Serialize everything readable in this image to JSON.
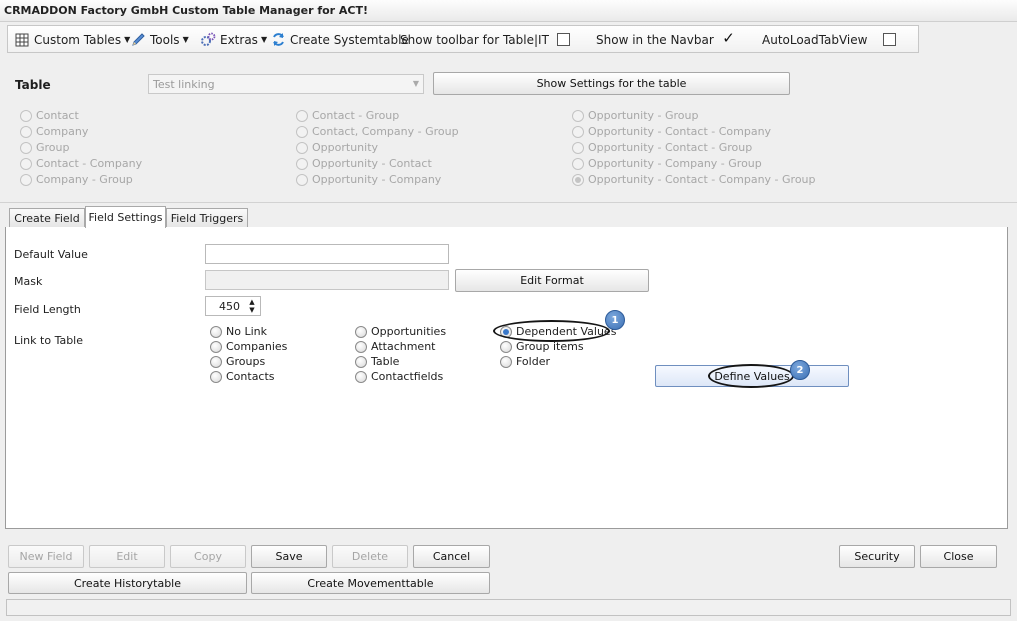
{
  "window": {
    "title": "CRMADDON Factory GmbH Custom Table Manager for ACT!"
  },
  "toolbar": {
    "custom_tables": "Custom Tables",
    "tools": "Tools",
    "extras": "Extras",
    "create_systemtable": "Create Systemtable",
    "show_toolbar": "Show toolbar for Table|IT",
    "show_toolbar_checked": false,
    "show_navbar": "Show in the Navbar",
    "show_navbar_checked": true,
    "autoload": "AutoLoadTabView",
    "autoload_checked": false,
    "checked_mark": "✓"
  },
  "table_panel": {
    "label": "Table",
    "selected_table": "Test linking",
    "show_settings_button": "Show Settings for the table",
    "link_options": {
      "col1": [
        "Contact",
        "Company",
        "Group",
        "Contact - Company",
        "Company - Group"
      ],
      "col2": [
        "Contact - Group",
        "Contact, Company - Group",
        "Opportunity",
        "Opportunity - Contact",
        "Opportunity - Company"
      ],
      "col3": [
        "Opportunity - Group",
        "Opportunity - Contact - Company",
        "Opportunity - Contact - Group",
        "Opportunity - Company - Group",
        "Opportunity - Contact - Company - Group"
      ]
    },
    "selected_link": "Opportunity - Contact - Company - Group"
  },
  "tabs": [
    {
      "label": "Create Field",
      "active": false
    },
    {
      "label": "Field Settings",
      "active": true
    },
    {
      "label": "Field Triggers",
      "active": false
    }
  ],
  "field_settings": {
    "default_value_label": "Default Value",
    "default_value": "",
    "mask_label": "Mask",
    "mask_value": "",
    "edit_format_button": "Edit Format",
    "field_length_label": "Field Length",
    "field_length_value": "450",
    "link_to_table_label": "Link to Table",
    "link_options": {
      "col1": [
        "No Link",
        "Companies",
        "Groups",
        "Contacts"
      ],
      "col2": [
        "Opportunities",
        "Attachment",
        "Table",
        "Contactfields"
      ],
      "col3": [
        "Dependent Values",
        "Group items",
        "Folder"
      ]
    },
    "selected_link": "Dependent Values",
    "define_values_button": "Define Values"
  },
  "callouts": [
    "1",
    "2"
  ],
  "buttons": {
    "new_field": "New Field",
    "edit": "Edit",
    "copy": "Copy",
    "save": "Save",
    "delete": "Delete",
    "cancel": "Cancel",
    "security": "Security",
    "close": "Close",
    "create_historytable": "Create Historytable",
    "create_movementtable": "Create Movementtable"
  },
  "status": {
    "text": ""
  }
}
